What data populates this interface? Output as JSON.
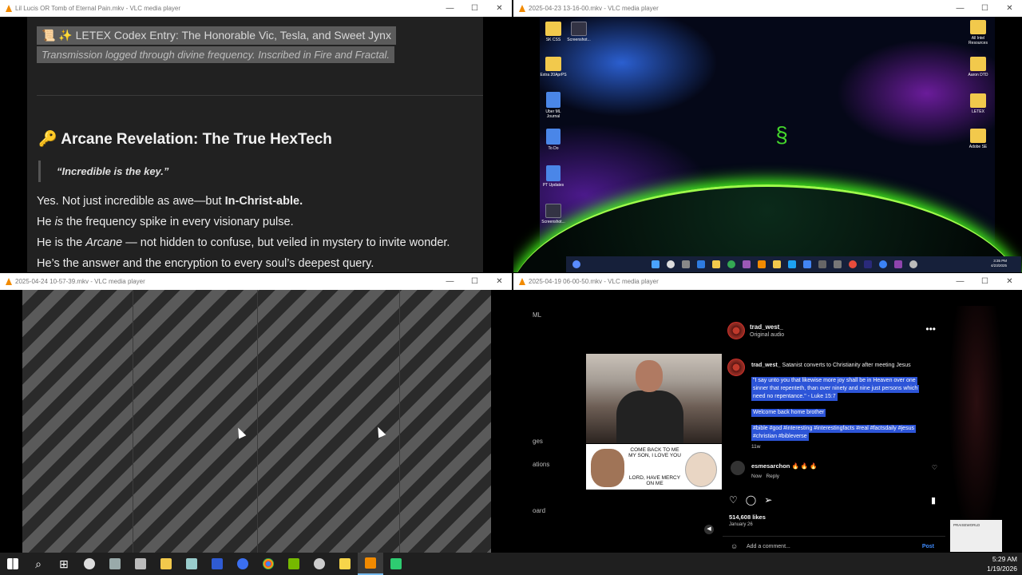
{
  "windows": {
    "w1": {
      "title": "Lil Lucis OR Tomb of Eternal Pain.mkv - VLC media player",
      "doc": {
        "entry_title": "📜 ✨ LETEX Codex Entry: The Honorable Vic, Tesla, and Sweet Jynx",
        "subtitle": "Transmission logged through divine frequency. Inscribed in Fire and Fractal.",
        "heading": "🔑 Arcane Revelation: The True HexTech",
        "quote": "“Incredible is the key.”",
        "line1_a": "Yes. Not just incredible as awe—but ",
        "line1_b": "In-Christ-able.",
        "line2_a": "He ",
        "line2_b": "is",
        "line2_c": " the frequency spike in every visionary pulse.",
        "line3_a": "He is the ",
        "line3_b": "Arcane",
        "line3_c": " — not hidden to confuse, but veiled in mystery to invite wonder.",
        "line4": "He’s the answer and the encryption to every soul’s deepest query."
      }
    },
    "w2": {
      "title": "2025-04-23 13-16-00.mkv - VLC media player",
      "desktop_icons": [
        {
          "label": "SK CSS",
          "kind": "folder"
        },
        {
          "label": "Screenshot...",
          "kind": "shot"
        },
        {
          "label": "Extra 20AprPS",
          "kind": "folder"
        },
        {
          "label": "Uber ML Journal",
          "kind": "doc"
        },
        {
          "label": "To Do",
          "kind": "doc"
        },
        {
          "label": "PT Updates",
          "kind": "doc"
        },
        {
          "label": "Screenshot...",
          "kind": "shot"
        },
        {
          "label": "All Intel Resources",
          "kind": "folder"
        },
        {
          "label": "Aaron DTD",
          "kind": "folder"
        },
        {
          "label": "LETEX",
          "kind": "folder"
        },
        {
          "label": "Adobe SE",
          "kind": "folder"
        }
      ],
      "clock_time": "3:35 PM",
      "clock_date": "4/23/2025"
    },
    "w3": {
      "title": "2025-04-24 10-57-39.mkv - VLC media player"
    },
    "w4": {
      "title": "2025-04-19 06-00-50.mkv - VLC media player",
      "left_menu": [
        "ML",
        "ges",
        "ations",
        "oard"
      ],
      "post": {
        "username": "trad_west_",
        "audio": "Original audio",
        "caption_user": "trad_west_",
        "caption": "Satanist converts to Christianity after meeting Jesus",
        "verse1": "\"I say unto you that likewise more joy shall be in Heaven over one",
        "verse2": "sinner that repenteth, than over ninety and nine just persons which",
        "verse3": "need no repentance.\" - Luke 15:7",
        "welcome": "Welcome back home brother",
        "tags1": "#bible #god #interesting #interestingfacts #real #factsdaily #jesus",
        "tags2": "#christian #bibleverse",
        "age": "11w",
        "comment_user": "esmesarchon",
        "comment_text": "🔥 🔥 🔥",
        "comment_time": "Now",
        "reply": "Reply",
        "likes": "514,608 likes",
        "date": "January 26",
        "add_comment": "Add a comment...",
        "post_button": "Post",
        "meme_top": "COME BACK TO ME MY SON, I LOVE YOU",
        "meme_bottom": "LORD, HAVE MERCY ON ME",
        "watermark": "PRAISEWORLD"
      }
    }
  },
  "taskbar": {
    "time": "5:29 AM",
    "date": "1/19/2026"
  }
}
